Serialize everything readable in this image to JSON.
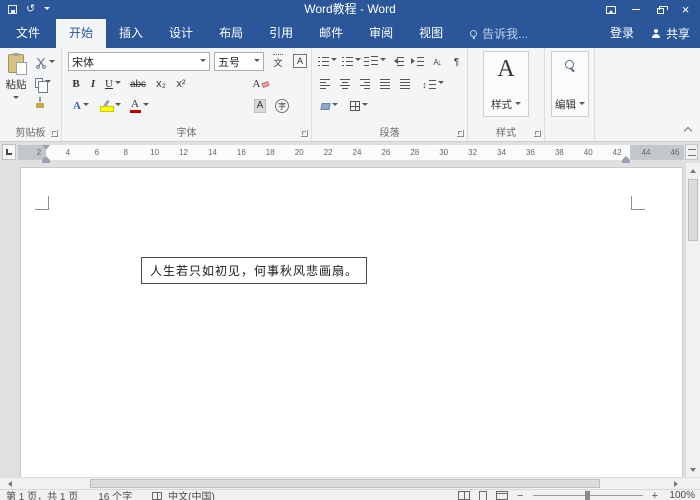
{
  "colors": {
    "brand_blue": "#2B579A",
    "ribbon_bg": "#F4F5F6",
    "highlight_yellow": "#FFFF00",
    "font_color_red": "#C00000"
  },
  "titlebar": {
    "title": "Word教程 - Word"
  },
  "tabs": {
    "file": "文件",
    "items": [
      {
        "label": "开始",
        "active": true
      },
      {
        "label": "插入",
        "active": false
      },
      {
        "label": "设计",
        "active": false
      },
      {
        "label": "布局",
        "active": false
      },
      {
        "label": "引用",
        "active": false
      },
      {
        "label": "邮件",
        "active": false
      },
      {
        "label": "审阅",
        "active": false
      },
      {
        "label": "视图",
        "active": false
      }
    ],
    "tell_me": "告诉我...",
    "sign_in": "登录",
    "share": "共享"
  },
  "ribbon": {
    "clipboard": {
      "paste_label": "粘贴",
      "group_label": "剪贴板"
    },
    "font": {
      "family": "宋体",
      "size": "五号",
      "bold": "B",
      "italic": "I",
      "underline": "U",
      "strikethrough": "abc",
      "subscript": "x₂",
      "superscript": "x²",
      "clear_formatting": "A",
      "text_effects": "A",
      "font_color": "A",
      "char_shading": "A",
      "enclose_char": "字",
      "phonetic_guide": "文",
      "char_border": "A",
      "group_label": "字体"
    },
    "paragraph": {
      "group_label": "段落"
    },
    "styles": {
      "gallery_letter": "A",
      "button_label": "样式",
      "group_label": "样式"
    },
    "editing": {
      "button_label": "编辑"
    }
  },
  "ruler": {
    "numbers": [
      "2",
      "4",
      "6",
      "8",
      "10",
      "12",
      "14",
      "16",
      "18",
      "20",
      "22",
      "24",
      "26",
      "28",
      "30",
      "32",
      "34",
      "36",
      "38",
      "40",
      "42",
      "44",
      "46"
    ]
  },
  "document": {
    "paragraph_text": "人生若只如初见，何事秋风悲画扇。"
  },
  "statusbar": {
    "page_info": "第 1 页，共 1 页",
    "word_count": "16 个字",
    "language": "中文(中国)",
    "zoom_level": "100%"
  }
}
